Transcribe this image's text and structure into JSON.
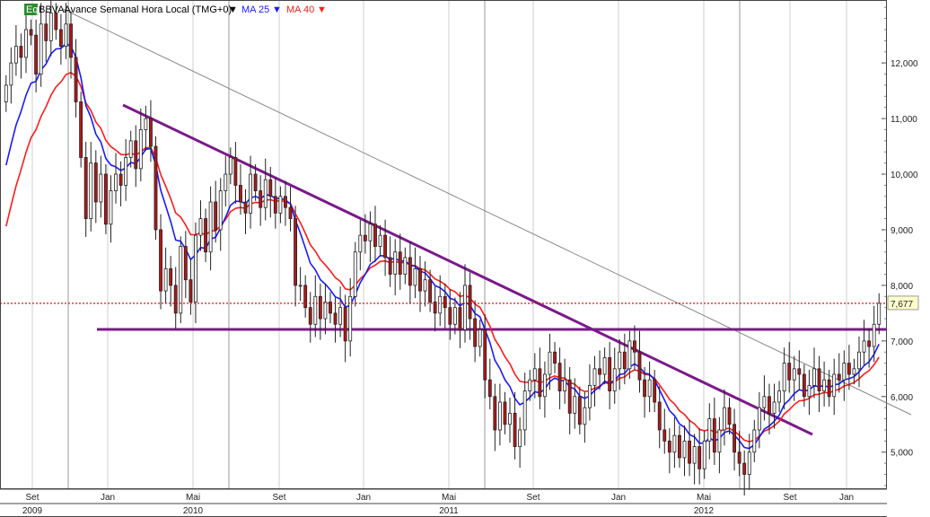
{
  "header": {
    "icon_label": "Eq",
    "symbol_title": "BBVA",
    "subtitle": "Avance Semanal Hora Local (TMG+0)",
    "ma1_label": "MA 25",
    "ma2_label": "MA 40",
    "dropdown_glyph": "▼"
  },
  "colors": {
    "background": "#ffffff",
    "candle_up_body": "#ffffff",
    "candle_down_body": "#b01818",
    "wick": "#222222",
    "ma25": "#1a1aff",
    "ma40": "#ff1a1a",
    "trendline": "#7a1a8a",
    "thin_trendline": "#888888",
    "last_price_line": "#cc0000",
    "grid": "#cfcfcf"
  },
  "chart_data": {
    "type": "candlestick",
    "interval": "weekly",
    "title": "BBVA",
    "ylim": [
      4.35,
      13.1
    ],
    "yaxis_side": "right",
    "y_ticks": [
      {
        "value": 5,
        "label": "5,000"
      },
      {
        "value": 6,
        "label": "6,000"
      },
      {
        "value": 7,
        "label": "7,000"
      },
      {
        "value": 8,
        "label": "8,000"
      },
      {
        "value": 9,
        "label": "9,000"
      },
      {
        "value": 10,
        "label": "10,000"
      },
      {
        "value": 11,
        "label": "11,000"
      },
      {
        "value": 12,
        "label": "12,000"
      }
    ],
    "x_month_ticks": [
      {
        "label": "Set",
        "x": 36
      },
      {
        "label": "Jan",
        "x": 120
      },
      {
        "label": "Mai",
        "x": 215
      },
      {
        "label": "Set",
        "x": 311
      },
      {
        "label": "Jan",
        "x": 405
      },
      {
        "label": "Mai",
        "x": 500
      },
      {
        "label": "Set",
        "x": 594
      },
      {
        "label": "Jan",
        "x": 689
      },
      {
        "label": "Mai",
        "x": 784
      },
      {
        "label": "Set",
        "x": 880
      },
      {
        "label": "Jan",
        "x": 943
      }
    ],
    "x_year_ticks": [
      {
        "label": "2009",
        "x": 36
      },
      {
        "label": "2010",
        "x": 215
      },
      {
        "label": "2011",
        "x": 500
      },
      {
        "label": "2012",
        "x": 784
      }
    ],
    "closes": [
      11.6,
      12.0,
      12.3,
      12.1,
      12.6,
      12.5,
      11.8,
      12.7,
      12.4,
      12.9,
      12.6,
      12.3,
      12.7,
      12.1,
      11.3,
      10.3,
      9.2,
      10.2,
      9.5,
      10.0,
      9.1,
      9.7,
      10.0,
      9.8,
      10.3,
      10.6,
      10.1,
      10.8,
      11.0,
      10.5,
      9.0,
      7.9,
      8.3,
      8.0,
      7.5,
      8.7,
      8.1,
      7.7,
      8.9,
      9.2,
      8.6,
      9.5,
      9.0,
      9.7,
      10.0,
      10.3,
      9.8,
      9.5,
      9.3,
      10.0,
      9.7,
      9.4,
      9.9,
      9.6,
      9.3,
      9.6,
      9.4,
      9.2,
      8.0,
      8.0,
      7.6,
      7.3,
      7.8,
      7.4,
      7.7,
      7.5,
      7.3,
      7.6,
      7.0,
      7.8,
      8.6,
      8.9,
      8.8,
      9.1,
      8.7,
      8.9,
      8.5,
      8.2,
      8.6,
      8.2,
      8.5,
      8.0,
      8.3,
      7.9,
      8.1,
      7.7,
      7.5,
      7.8,
      7.6,
      7.3,
      7.6,
      7.2,
      8.0,
      7.4,
      6.9,
      7.2,
      6.3,
      6.0,
      5.4,
      5.9,
      5.5,
      5.7,
      5.1,
      5.4,
      6.1,
      6.3,
      6.5,
      6.0,
      6.4,
      6.8,
      6.6,
      6.1,
      6.3,
      5.7,
      6.0,
      5.5,
      5.8,
      6.2,
      6.5,
      6.4,
      6.7,
      6.1,
      6.5,
      6.8,
      6.5,
      7.0,
      6.8,
      6.3,
      6.0,
      6.3,
      5.9,
      5.4,
      5.2,
      5.0,
      5.3,
      4.9,
      5.2,
      4.8,
      5.1,
      4.7,
      5.2,
      5.6,
      5.0,
      5.4,
      5.8,
      5.5,
      5.0,
      4.8,
      4.6,
      5.0,
      5.4,
      5.8,
      6.0,
      5.7,
      5.9,
      6.1,
      6.6,
      6.3,
      6.5,
      6.4,
      6.0,
      6.2,
      6.5,
      6.1,
      6.3,
      6.0,
      6.4,
      6.3,
      6.6,
      6.4,
      6.5,
      6.8,
      7.0,
      6.9,
      7.3,
      7.677
    ]
  }
}
